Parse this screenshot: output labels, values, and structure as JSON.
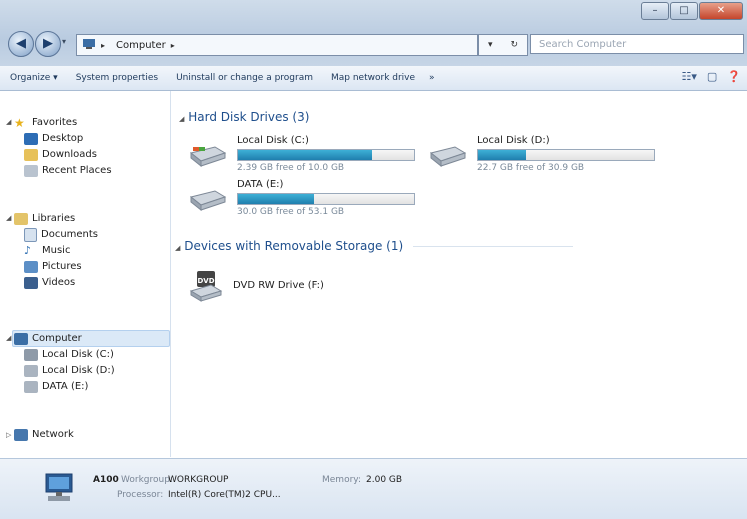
{
  "window": {
    "controls": [
      "–",
      "□",
      "✕"
    ]
  },
  "address": {
    "crumbs": [
      "Computer"
    ],
    "separator": "▸",
    "refresh": "↻",
    "dropdown": "▾"
  },
  "search": {
    "placeholder": "Search Computer"
  },
  "toolbar": {
    "items": [
      "Organize ▾",
      "System properties",
      "Uninstall or change a program",
      "Map network drive",
      "»"
    ]
  },
  "nav": {
    "favorites": {
      "label": "Favorites",
      "items": [
        "Desktop",
        "Downloads",
        "Recent Places"
      ]
    },
    "libraries": {
      "label": "Libraries",
      "items": [
        "Documents",
        "Music",
        "Pictures",
        "Videos"
      ]
    },
    "computer": {
      "label": "Computer",
      "items": [
        "Local Disk (C:)",
        "Local Disk (D:)",
        "DATA (E:)"
      ]
    },
    "network": {
      "label": "Network"
    }
  },
  "content": {
    "hdd_group": "Hard Disk Drives (3)",
    "removable_group": "Devices with Removable Storage (1)",
    "drives": [
      {
        "name": "Local Disk (C:)",
        "free": "2.39 GB free of 10.0 GB",
        "used_fraction": 0.76
      },
      {
        "name": "Local Disk (D:)",
        "free": "22.7 GB free of 30.9 GB",
        "used_fraction": 0.27
      },
      {
        "name": "DATA (E:)",
        "free": "30.0 GB free of 53.1 GB",
        "used_fraction": 0.43
      }
    ],
    "dvd": {
      "name": "DVD RW Drive (F:)"
    }
  },
  "details": {
    "name": "A100",
    "workgroup_label": "Workgroup:",
    "workgroup": "WORKGROUP",
    "memory_label": "Memory:",
    "memory": "2.00 GB",
    "processor_label": "Processor:",
    "processor": "Intel(R) Core(TM)2 CPU..."
  },
  "colors": {
    "accent": "#1e4e8c",
    "bar_fill": "#2a95c4",
    "selection": "#dbe9f7"
  }
}
